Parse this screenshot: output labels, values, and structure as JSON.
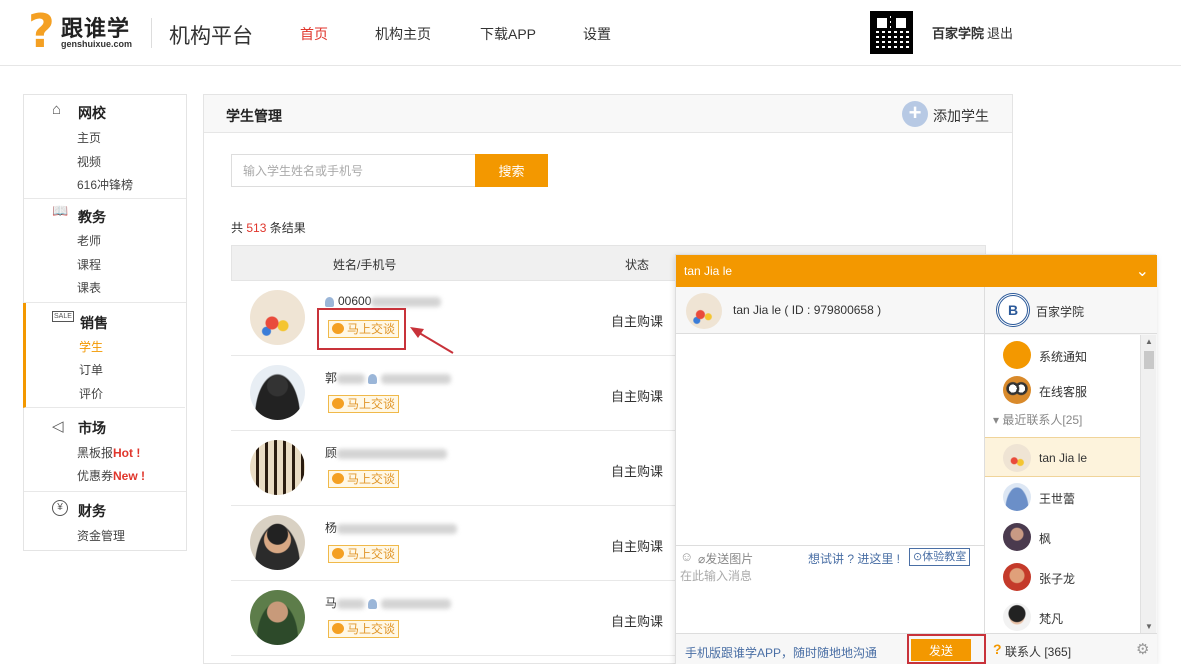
{
  "header": {
    "logo_char": "?",
    "logo_text": "跟谁学",
    "logo_sub": "genshuixue.com",
    "platform": "机构平台",
    "nav": [
      "首页",
      "机构主页",
      "下载APP",
      "设置"
    ],
    "user_name": "百家学院",
    "logout": "退出"
  },
  "sidebar": {
    "groups": [
      {
        "title": "网校",
        "icon": "home-icon",
        "items": [
          "主页",
          "视频",
          "616冲锋榜"
        ]
      },
      {
        "title": "教务",
        "icon": "book-icon",
        "items": [
          "老师",
          "课程",
          "课表"
        ]
      },
      {
        "title": "销售",
        "icon": "sale-icon",
        "items": [
          "学生",
          "订单",
          "评价"
        ]
      },
      {
        "title": "市场",
        "icon": "megaphone-icon",
        "items": [
          "黑板报",
          "优惠券"
        ]
      },
      {
        "title": "财务",
        "icon": "yen-icon",
        "items": [
          "资金管理"
        ]
      }
    ],
    "badges": {
      "hot": "Hot !",
      "new": "New !"
    },
    "icon_glyphs": {
      "home": "⌂",
      "book": "📖",
      "sale": "SALE",
      "megaphone": "◁",
      "yen": "¥"
    }
  },
  "main": {
    "title": "学生管理",
    "add_label": "添加学生",
    "search_placeholder": "输入学生姓名或手机号",
    "search_button": "搜索",
    "result_prefix": "共",
    "result_count": "513",
    "result_suffix": "条结果",
    "col_name": "姓名/手机号",
    "col_status": "状态",
    "chat_label": "马上交谈",
    "rows": [
      {
        "name": "00600",
        "status": "自主购课"
      },
      {
        "name": "郭",
        "status": "自主购课"
      },
      {
        "name": "顾",
        "status": "自主购课"
      },
      {
        "name": "杨",
        "status": "自主购课"
      },
      {
        "name": "马",
        "status": "自主购课"
      }
    ]
  },
  "chat": {
    "window_title": "tan Jia le",
    "contact_line": "tan Jia le ( ID : 979800658 )",
    "send_image": "发送图片",
    "try_text": "想试讲 ? 进这里 !",
    "classroom": "体验教室",
    "input_placeholder": "在此输入消息",
    "app_link": "手机版跟谁学APP，随时随地地沟通",
    "send": "发送",
    "org_name": "百家学院",
    "org_logo": "B",
    "system_notice": "系统通知",
    "online_service": "在线客服",
    "recent_label": "最近联系人[25]",
    "contacts": [
      "tan Jia le",
      "王世蕾",
      "枫",
      "张子龙",
      "梵凡"
    ],
    "contacts_total": "联系人 [365]"
  },
  "colors": {
    "accent": "#f39800",
    "red": "#e0362c",
    "link": "#4a6fa5"
  }
}
